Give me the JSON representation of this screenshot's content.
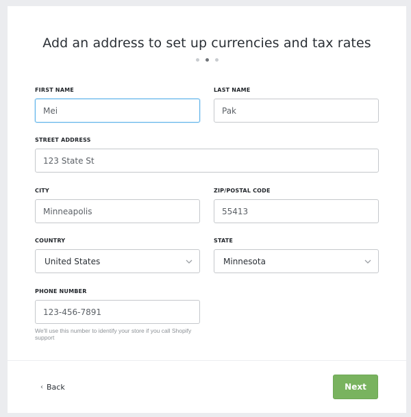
{
  "page": {
    "title": "Add an address to set up currencies and tax rates",
    "steps": {
      "total": 3,
      "current": 2
    }
  },
  "form": {
    "first_name": {
      "label": "FIRST NAME",
      "value": "Mei",
      "focused": true
    },
    "last_name": {
      "label": "LAST NAME",
      "value": "Pak"
    },
    "street_address": {
      "label": "STREET ADDRESS",
      "value": "123 State St"
    },
    "city": {
      "label": "CITY",
      "value": "Minneapolis"
    },
    "zip": {
      "label": "ZIP/POSTAL CODE",
      "value": "55413"
    },
    "country": {
      "label": "COUNTRY",
      "selected": "United States",
      "icon": "chevron-down-icon"
    },
    "state": {
      "label": "STATE",
      "selected": "Minnesota",
      "icon": "chevron-down-icon"
    },
    "phone": {
      "label": "PHONE NUMBER",
      "value": "123-456-7891",
      "help": "We'll use this number to identify your store if you call Shopify support"
    }
  },
  "footer": {
    "back_label": "Back",
    "back_icon": "chevron-left-icon",
    "next_label": "Next"
  },
  "colors": {
    "accent_green": "#79b35f",
    "focus_blue": "#5eb3ea",
    "background": "#ebecef"
  }
}
